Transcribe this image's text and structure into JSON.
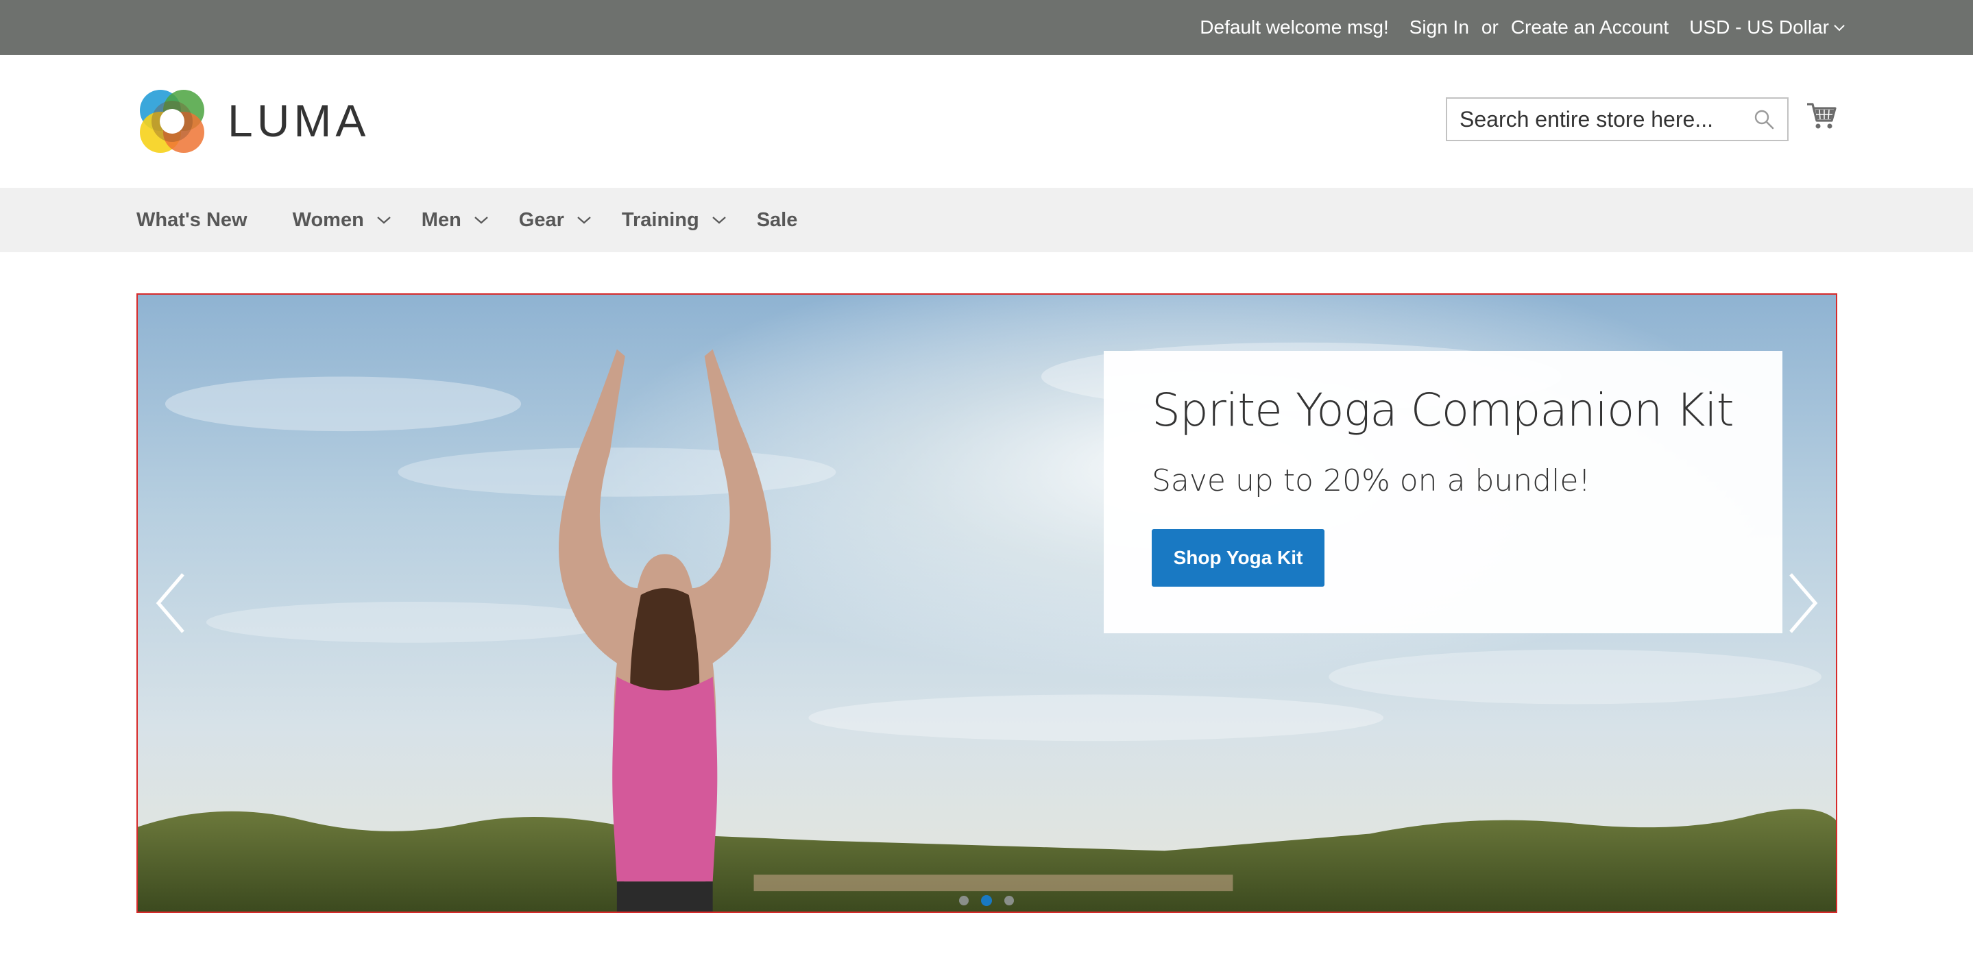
{
  "panel": {
    "welcome": "Default welcome msg!",
    "sign_in": "Sign In",
    "or": "or",
    "create_account": "Create an Account",
    "currency": "USD - US Dollar"
  },
  "header": {
    "logo_text": "LUMA",
    "search_placeholder": "Search entire store here...",
    "icons": {
      "search": "search-icon",
      "cart": "cart-icon"
    }
  },
  "nav": {
    "items": [
      {
        "label": "What's New",
        "has_submenu": false
      },
      {
        "label": "Women",
        "has_submenu": true
      },
      {
        "label": "Men",
        "has_submenu": true
      },
      {
        "label": "Gear",
        "has_submenu": true
      },
      {
        "label": "Training",
        "has_submenu": true
      },
      {
        "label": "Sale",
        "has_submenu": false
      }
    ]
  },
  "hero": {
    "title": "Sprite Yoga Companion Kit",
    "subtitle": "Save up to 20% on a bundle!",
    "button_label": "Shop Yoga Kit",
    "slides_count": 3,
    "active_slide": 2
  },
  "colors": {
    "panel_bg": "#6e716e",
    "nav_bg": "#f0f0f0",
    "button_blue": "#1979c3",
    "hero_border": "#d62a2a",
    "text_dark": "#333333"
  }
}
